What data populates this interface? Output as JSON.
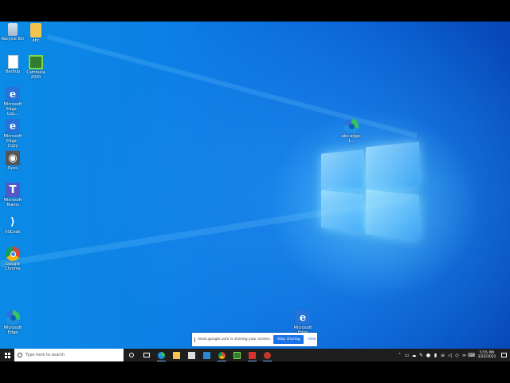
{
  "desktop": {
    "icons": [
      {
        "label": "Recycle Bin",
        "glyph": "",
        "name": "recycle-bin-icon"
      },
      {
        "label": "abc",
        "glyph": "",
        "name": "folder-icon"
      },
      {
        "label": "Backup",
        "glyph": "",
        "name": "file-icon"
      },
      {
        "label": "Camtasia 2020",
        "glyph": "",
        "name": "camtasia-icon"
      },
      {
        "label": "Microsoft Edge - Cop...",
        "glyph": "e",
        "name": "edge-legacy-icon"
      },
      {
        "label": "Microsoft Edge - Copy",
        "glyph": "e",
        "name": "edge-legacy-icon"
      },
      {
        "label": "Eyes",
        "glyph": "◉",
        "name": "eye-icon"
      },
      {
        "label": "Microsoft Teams",
        "glyph": "T",
        "name": "teams-icon"
      },
      {
        "label": "VSCode",
        "glyph": "⟩",
        "name": "vscode-icon"
      },
      {
        "label": "Google Chrome",
        "glyph": "",
        "name": "chrome-icon"
      },
      {
        "label": "Microsoft Edge",
        "glyph": "",
        "name": "edge-icon"
      },
      {
        "label": "abc-edge-1...",
        "glyph": "",
        "name": "edge-icon"
      },
      {
        "label": "Microsoft Edge",
        "glyph": "e",
        "name": "edge-legacy-icon"
      }
    ]
  },
  "share_banner": {
    "message": "meet.google.com is sharing your screen.",
    "stop_label": "Stop sharing",
    "hide_label": "Hide"
  },
  "taskbar": {
    "search_placeholder": "Type here to search",
    "pinned": [
      {
        "name": "cortana-icon",
        "glyph": ""
      },
      {
        "name": "task-view-icon",
        "glyph": ""
      },
      {
        "name": "edge-icon",
        "glyph": ""
      },
      {
        "name": "file-explorer-icon",
        "glyph": ""
      },
      {
        "name": "store-icon",
        "glyph": ""
      },
      {
        "name": "mail-icon",
        "glyph": ""
      },
      {
        "name": "chrome-icon",
        "glyph": ""
      },
      {
        "name": "camtasia-icon",
        "glyph": ""
      },
      {
        "name": "red-app-icon",
        "glyph": ""
      },
      {
        "name": "recorder-icon",
        "glyph": ""
      }
    ],
    "tray_icons": [
      "chevron-up-icon",
      "device-icon",
      "onedrive-icon",
      "pen-icon",
      "microphone-icon",
      "battery-icon",
      "network-icon",
      "volume-icon",
      "dropbox-icon",
      "link-icon",
      "keyboard-icon"
    ],
    "time": "5:55 PM",
    "date": "3/22/2021"
  }
}
